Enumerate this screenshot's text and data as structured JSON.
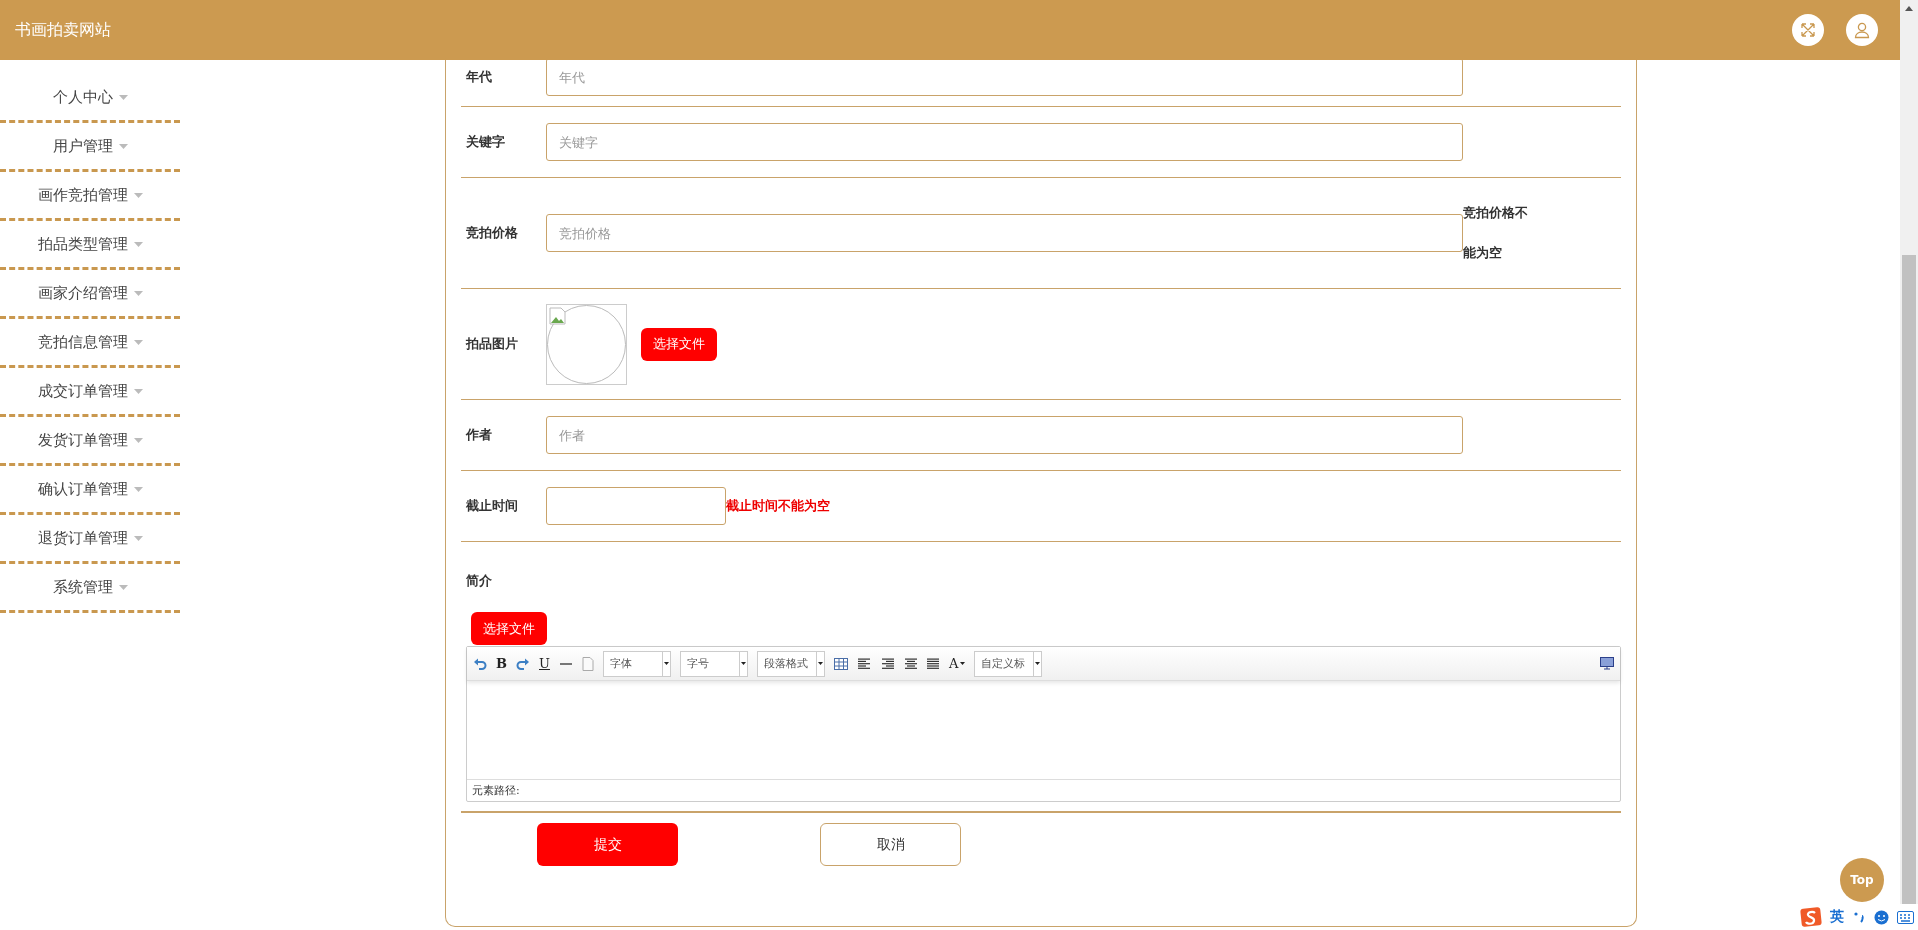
{
  "header": {
    "title": "书画拍卖网站"
  },
  "sidebar": {
    "items": [
      {
        "label": "个人中心"
      },
      {
        "label": "用户管理"
      },
      {
        "label": "画作竞拍管理"
      },
      {
        "label": "拍品类型管理"
      },
      {
        "label": "画家介绍管理"
      },
      {
        "label": "竞拍信息管理"
      },
      {
        "label": "成交订单管理"
      },
      {
        "label": "发货订单管理"
      },
      {
        "label": "确认订单管理"
      },
      {
        "label": "退货订单管理"
      },
      {
        "label": "系统管理"
      }
    ]
  },
  "form": {
    "fields": [
      {
        "kind": "text",
        "label": "年代",
        "placeholder": "年代"
      },
      {
        "kind": "text",
        "label": "关键字",
        "placeholder": "关键字"
      },
      {
        "kind": "text",
        "label": "竞拍价格",
        "placeholder": "竞拍价格",
        "error": {
          "text": "竞拍价格不能为空",
          "color": "#333333"
        }
      },
      {
        "kind": "image",
        "label": "拍品图片",
        "button": "选择文件"
      },
      {
        "kind": "text",
        "label": "作者",
        "placeholder": "作者"
      },
      {
        "kind": "date",
        "label": "截止时间",
        "error": {
          "text": "截止时间不能为空",
          "color": "#ee0000"
        }
      },
      {
        "kind": "editor",
        "label": "简介",
        "button": "选择文件",
        "toolbar": [
          {
            "kind": "undo"
          },
          {
            "kind": "bold",
            "text": "B"
          },
          {
            "kind": "redo"
          },
          {
            "kind": "underline",
            "text": "U"
          },
          {
            "kind": "rule"
          },
          {
            "kind": "page"
          },
          {
            "kind": "select",
            "text": "字体"
          },
          {
            "kind": "select",
            "text": "字号"
          },
          {
            "kind": "select",
            "text": "段落格式"
          },
          {
            "kind": "table"
          },
          {
            "kind": "align-left"
          },
          {
            "kind": "align-right"
          },
          {
            "kind": "align-center"
          },
          {
            "kind": "justify"
          },
          {
            "kind": "font-color",
            "text": "A"
          },
          {
            "kind": "select",
            "text": "自定义标"
          },
          {
            "kind": "preview"
          }
        ],
        "status": "元素路径:"
      }
    ]
  },
  "actions": [
    {
      "kind": "primary",
      "label": "提交"
    },
    {
      "kind": "secondary",
      "label": "取消"
    }
  ],
  "top_button": "Top",
  "ime": {
    "label": "英"
  }
}
